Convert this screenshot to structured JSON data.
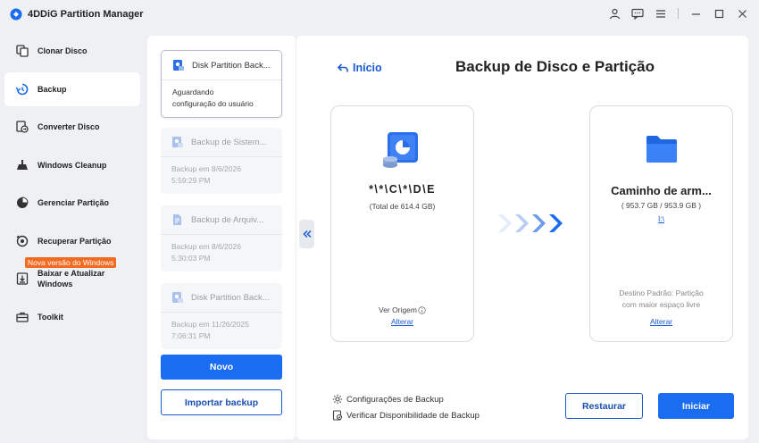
{
  "app": {
    "title": "4DDiG Partition Manager"
  },
  "sidebar": {
    "items": [
      {
        "label": "Clonar Disco"
      },
      {
        "label": "Backup"
      },
      {
        "label": "Converter Disco"
      },
      {
        "label": "Windows Cleanup"
      },
      {
        "label": "Gerenciar Partição"
      },
      {
        "label": "Recuperar Partição"
      },
      {
        "label": "Baixar e Atualizar Windows"
      },
      {
        "label": "Toolkit"
      }
    ],
    "badge": "Nova versão do Windows"
  },
  "list": {
    "cards": [
      {
        "title": "Disk Partition Back...",
        "line1": "Aguardando",
        "line2": "configuração do usuário"
      },
      {
        "title": "Backup de Sistem...",
        "line1": "Backup em 8/6/2026",
        "line2": "5:59:29 PM"
      },
      {
        "title": "Backup de Arquiv...",
        "line1": "Backup em 8/6/2026",
        "line2": "5:30:03 PM"
      },
      {
        "title": "Disk Partition Back...",
        "line1": "Backup em 11/26/2025",
        "line2": "7:06:31 PM"
      }
    ],
    "new_button": "Novo",
    "import_button": "Importar backup"
  },
  "main": {
    "back_label": "Início",
    "title": "Backup de Disco e Partição",
    "source": {
      "name": "*\\*\\C\\*\\D\\E",
      "size": "(Total de 614.4 GB)",
      "view_label": "Ver Origem",
      "change_link": "Alterar"
    },
    "dest": {
      "name": "Caminho de arm...",
      "size": "( 953.7 GB / 953.9 GB )",
      "path": "I:\\",
      "default_line1": "Destino Padrão: Partição",
      "default_line2": "com maior espaço livre",
      "change_link": "Alterar"
    },
    "options": {
      "settings": "Configurações de Backup",
      "verify": "Verificar Disponibilidade de Backup"
    },
    "restore_button": "Restaurar",
    "start_button": "Iniciar"
  },
  "colors": {
    "accent": "#1a6cf0",
    "badge": "#f26b22"
  }
}
